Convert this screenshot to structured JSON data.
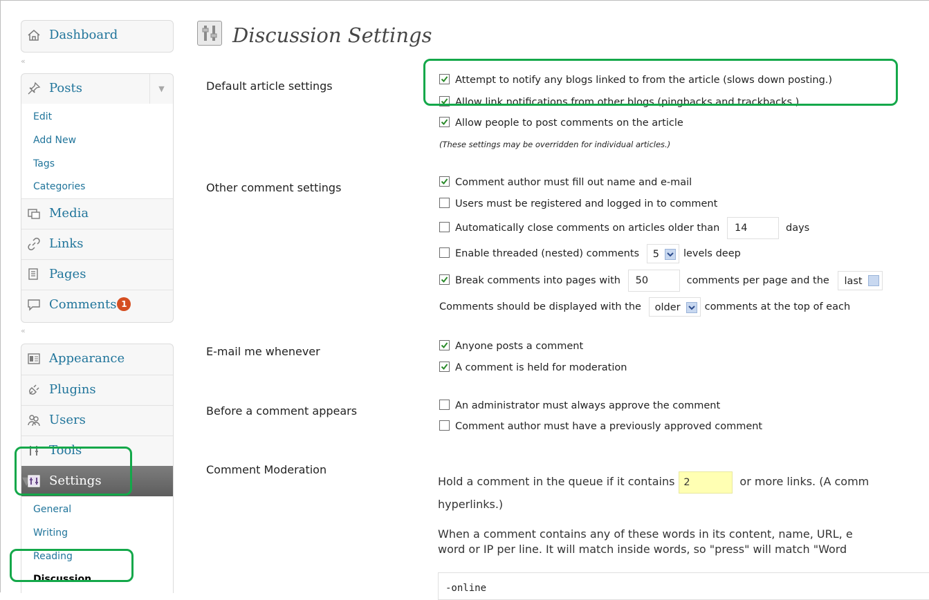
{
  "sidebar": {
    "dashboard": {
      "label": "Dashboard",
      "icon": "home-icon"
    },
    "posts": {
      "label": "Posts",
      "icon": "pin-icon",
      "submenu": [
        "Edit",
        "Add New",
        "Tags",
        "Categories"
      ]
    },
    "media": {
      "label": "Media",
      "icon": "media-icon"
    },
    "links": {
      "label": "Links",
      "icon": "link-icon"
    },
    "pages": {
      "label": "Pages",
      "icon": "pages-icon"
    },
    "comments": {
      "label": "Comments",
      "icon": "comment-icon",
      "badge": "1"
    },
    "appearance": {
      "label": "Appearance",
      "icon": "appearance-icon"
    },
    "plugins": {
      "label": "Plugins",
      "icon": "plugin-icon"
    },
    "users": {
      "label": "Users",
      "icon": "users-icon"
    },
    "tools": {
      "label": "Tools",
      "icon": "tools-icon"
    },
    "settings": {
      "label": "Settings",
      "icon": "settings-icon",
      "submenu": [
        "General",
        "Writing",
        "Reading",
        "Discussion"
      ],
      "current": "Discussion"
    }
  },
  "page": {
    "title": "Discussion Settings",
    "icon": "settings-page-icon"
  },
  "sections": {
    "default_article": {
      "label": "Default article settings",
      "options": [
        {
          "label": "Attempt to notify any blogs linked to from the article (slows down posting.)",
          "checked": true
        },
        {
          "label": "Allow link notifications from other blogs (pingbacks and trackbacks.)",
          "checked": true
        },
        {
          "label": "Allow people to post comments on the article",
          "checked": true
        }
      ],
      "note": "(These settings may be overridden for individual articles.)"
    },
    "other_comment": {
      "label": "Other comment settings",
      "opt1": {
        "label": "Comment author must fill out name and e-mail",
        "checked": true
      },
      "opt2": {
        "label": "Users must be registered and logged in to comment",
        "checked": false
      },
      "opt3": {
        "label_before": "Automatically close comments on articles older than",
        "value": "14",
        "label_after": "days",
        "checked": false
      },
      "opt4": {
        "label_before": "Enable threaded (nested) comments",
        "value": "5",
        "label_after": "levels deep",
        "checked": false
      },
      "opt5": {
        "label_before": "Break comments into pages with",
        "value": "50",
        "label_mid": "comments per page and the",
        "select": "last",
        "checked": true
      },
      "opt6": {
        "label_before": "Comments should be displayed with the",
        "select": "older",
        "label_after": "comments at the top of each"
      }
    },
    "email_me": {
      "label": "E-mail me whenever",
      "options": [
        {
          "label": "Anyone posts a comment",
          "checked": true
        },
        {
          "label": "A comment is held for moderation",
          "checked": true
        }
      ]
    },
    "before_appears": {
      "label": "Before a comment appears",
      "options": [
        {
          "label": "An administrator must always approve the comment",
          "checked": false
        },
        {
          "label": "Comment author must have a previously approved comment",
          "checked": false
        }
      ]
    },
    "moderation": {
      "label": "Comment Moderation",
      "hold_before": "Hold a comment in the queue if it contains",
      "hold_value": "2",
      "hold_after": "or more links. (A comm",
      "hold_line2": "hyperlinks.)",
      "words_line1": "When a comment contains any of these words in its content, name, URL, e",
      "words_line2": "word or IP per line. It will match inside words, so \"press\" will match \"Word",
      "textarea_value": "-online"
    }
  },
  "colors": {
    "link": "#21759b",
    "callout": "#14a84a",
    "badge": "#d54e21",
    "highlight": "#ffffb3"
  }
}
